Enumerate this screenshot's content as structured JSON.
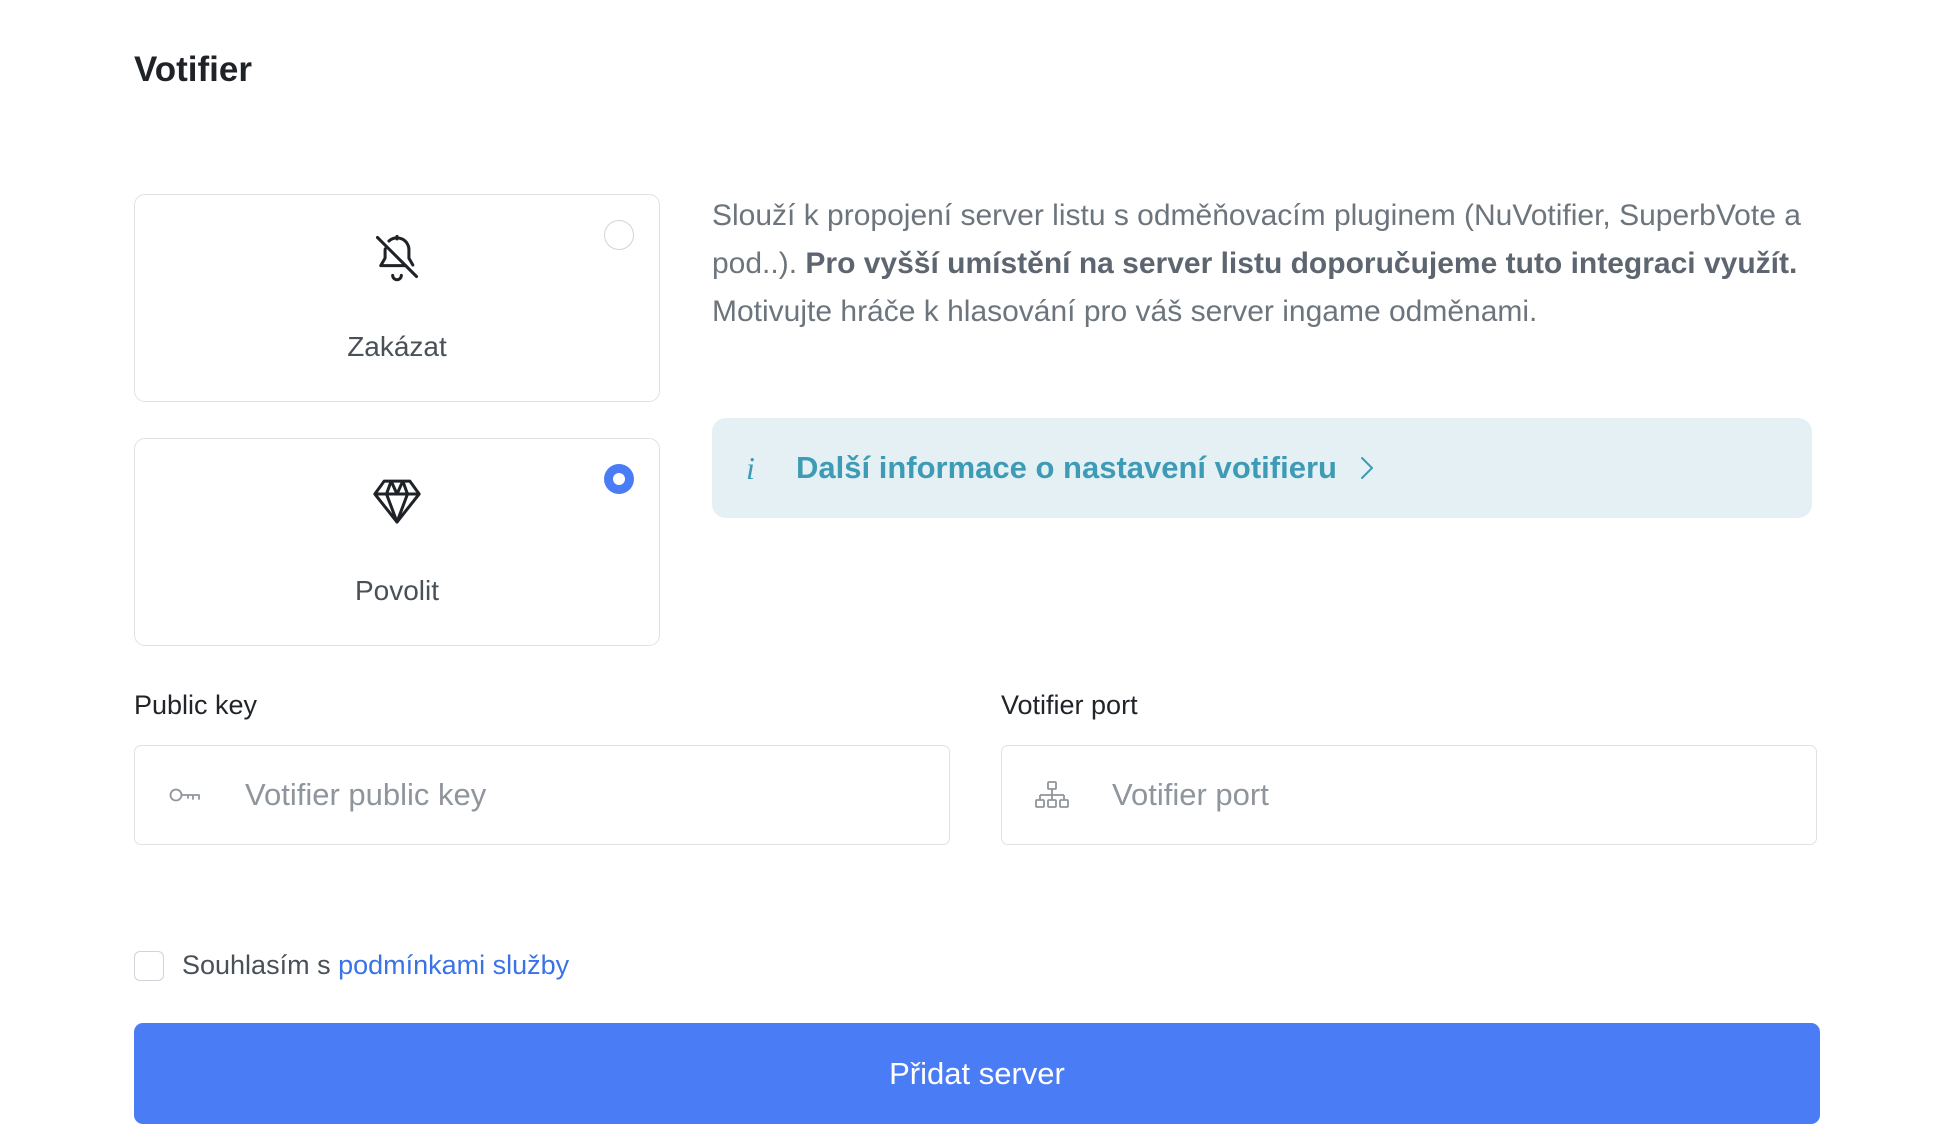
{
  "section": {
    "title": "Votifier"
  },
  "options": [
    {
      "label": "Zakázat",
      "icon": "bell-off-icon",
      "selected": false
    },
    {
      "label": "Povolit",
      "icon": "diamond-icon",
      "selected": true
    }
  ],
  "description": {
    "part1": "Slouží k propojení server listu s odměňovacím pluginem (NuVotifier, SuperbVote a pod..). ",
    "bold": "Pro vyšší umístění na server listu doporučujeme tuto integraci využít.",
    "part2": " Motivujte hráče k hlasování pro váš server ingame odměnami."
  },
  "info_link": {
    "icon": "info-icon",
    "text": "Další informace o nastavení votifieru",
    "chevron": "chevron-right-icon"
  },
  "fields": {
    "public_key": {
      "label": "Public key",
      "placeholder": "Votifier public key",
      "value": "",
      "icon": "key-icon"
    },
    "port": {
      "label": "Votifier port",
      "placeholder": "Votifier port",
      "value": "",
      "icon": "network-icon"
    }
  },
  "agree": {
    "text": "Souhlasím s ",
    "link": "podmínkami služby",
    "checked": false
  },
  "submit": {
    "label": "Přidat server"
  },
  "colors": {
    "accent": "#4a7cf5",
    "info_bg": "#e4f0f4",
    "info_text": "#3e9bb5",
    "link": "#3a72e8"
  }
}
